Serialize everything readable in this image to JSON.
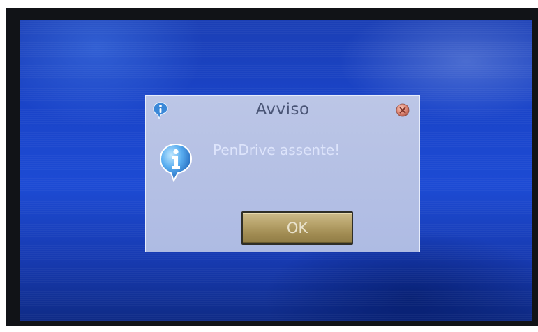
{
  "dialog": {
    "title": "Avviso",
    "message": "PenDrive assente!",
    "ok_label": "OK"
  },
  "icons": {
    "title": "info-icon",
    "body": "info-icon",
    "close": "close-icon"
  },
  "colors": {
    "screen_background": "#1d4bd4",
    "dialog_background": "#b4c0e6",
    "title_text": "#4a5576",
    "message_text": "#dde4fb",
    "ok_button": "#b8a46c",
    "close_button": "#e08a78"
  }
}
